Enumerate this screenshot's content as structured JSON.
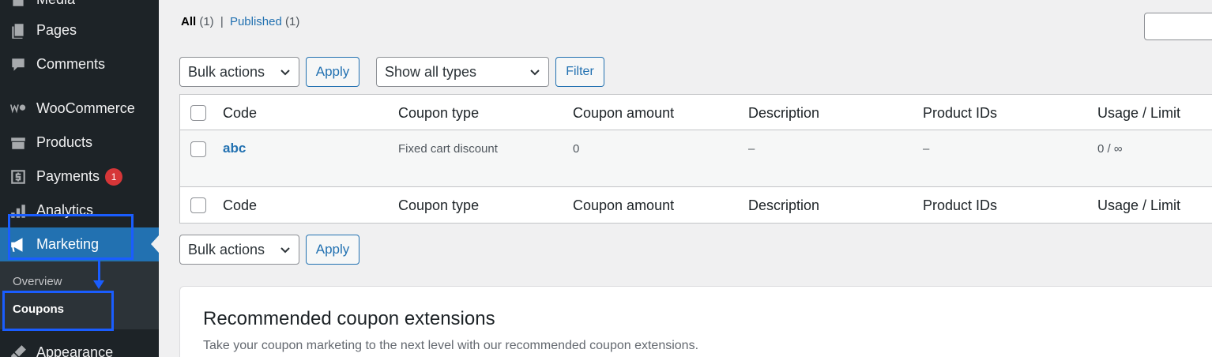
{
  "sidebar": {
    "items": [
      {
        "label": "Media",
        "icon": "media-icon"
      },
      {
        "label": "Pages",
        "icon": "pages-icon"
      },
      {
        "label": "Comments",
        "icon": "comments-icon"
      },
      {
        "label": "WooCommerce",
        "icon": "woocommerce-icon"
      },
      {
        "label": "Products",
        "icon": "products-icon"
      },
      {
        "label": "Payments",
        "icon": "payments-icon",
        "badge": "1"
      },
      {
        "label": "Analytics",
        "icon": "analytics-icon"
      },
      {
        "label": "Marketing",
        "icon": "megaphone-icon"
      },
      {
        "label": "Appearance",
        "icon": "appearance-icon"
      }
    ],
    "submenu": [
      {
        "label": "Overview"
      },
      {
        "label": "Coupons"
      }
    ]
  },
  "filters": {
    "all_label": "All",
    "all_count": "(1)",
    "separator": "|",
    "published_label": "Published",
    "published_count": "(1)"
  },
  "top_actions": {
    "bulk_label": "Bulk actions",
    "apply_label": "Apply",
    "type_label": "Show all types",
    "filter_label": "Filter"
  },
  "table": {
    "columns": [
      "Code",
      "Coupon type",
      "Coupon amount",
      "Description",
      "Product IDs",
      "Usage / Limit"
    ],
    "rows": [
      {
        "code": "abc",
        "type": "Fixed cart discount",
        "amount": "0",
        "description": "–",
        "product_ids": "–",
        "usage": "0 / ∞"
      }
    ]
  },
  "bottom_actions": {
    "bulk_label": "Bulk actions",
    "apply_label": "Apply"
  },
  "recommend": {
    "title": "Recommended coupon extensions",
    "subtitle": "Take your coupon marketing to the next level with our recommended coupon extensions."
  },
  "colors": {
    "sidebar_bg": "#1d2327",
    "accent": "#2271b1",
    "highlight": "#1a5dff",
    "badge": "#d63638"
  }
}
